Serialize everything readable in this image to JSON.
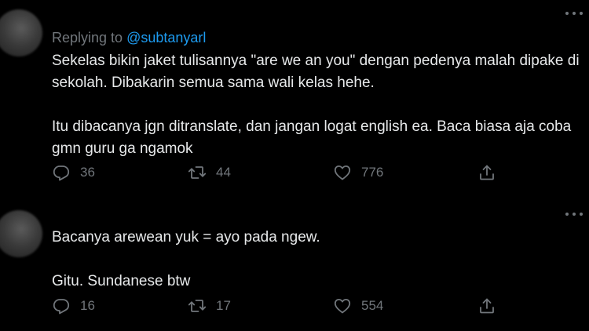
{
  "colors": {
    "background": "#000000",
    "text": "#e7e9ea",
    "muted": "#71767b",
    "accent": "#1d9bf0"
  },
  "tweets": [
    {
      "replying_prefix": "Replying to ",
      "replying_handle": "@subtanyarl",
      "paragraphs": [
        "Sekelas bikin jaket tulisannya \"are we an you\" dengan pedenya malah dipake di sekolah. Dibakarin semua sama wali kelas hehe.",
        "Itu dibacanya jgn ditranslate, dan jangan logat english ea. Baca biasa aja coba gmn guru ga ngamok"
      ],
      "replies": "36",
      "retweets": "44",
      "likes": "776",
      "icons": [
        "reply-icon",
        "retweet-icon",
        "like-icon",
        "share-icon",
        "more-icon"
      ]
    },
    {
      "paragraphs": [
        "Bacanya arewean yuk = ayo pada ngew.",
        "Gitu. Sundanese btw"
      ],
      "replies": "16",
      "retweets": "17",
      "likes": "554",
      "icons": [
        "reply-icon",
        "retweet-icon",
        "like-icon",
        "share-icon",
        "more-icon"
      ]
    }
  ]
}
